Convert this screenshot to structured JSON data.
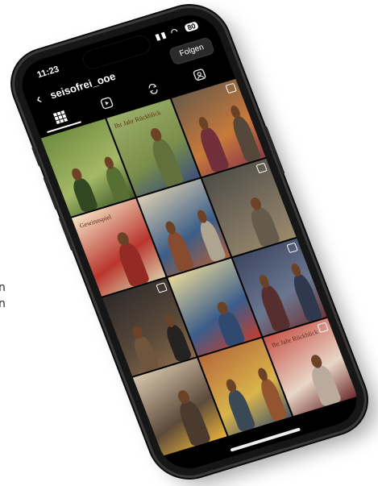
{
  "side_text": {
    "line1": "n",
    "line2": "n"
  },
  "status": {
    "time": "11:23",
    "battery": "80",
    "signal_icon": "signal-icon",
    "wifi_icon": "wifi-icon"
  },
  "profile": {
    "username": "seisofrei_ooe",
    "follow_label": "Folgen"
  },
  "tabs": [
    {
      "name": "grid-icon",
      "active": true
    },
    {
      "name": "reels-icon",
      "active": false
    },
    {
      "name": "repost-icon",
      "active": false
    },
    {
      "name": "tagged-icon",
      "active": false
    }
  ],
  "posts": [
    {
      "overlay": "",
      "caption": "",
      "colors": [
        "#6d8b3f",
        "#a5b866",
        "#3e5a2a"
      ]
    },
    {
      "overlay": "Ihr Jahr Rückblick",
      "caption": "",
      "colors": [
        "#9bb06a",
        "#7a8d4a",
        "#3b4f7a"
      ]
    },
    {
      "overlay": "",
      "caption": "",
      "colors": [
        "#6a5a4a",
        "#c87a3a",
        "#8d3a4a"
      ]
    },
    {
      "overlay": "Gewinnspiel",
      "caption": "",
      "colors": [
        "#f4e3c6",
        "#b9352d",
        "#d9c9a6"
      ]
    },
    {
      "overlay": "",
      "caption": "",
      "colors": [
        "#d9cdb3",
        "#3c5d86",
        "#a95f3b"
      ]
    },
    {
      "overlay": "",
      "caption": "",
      "colors": [
        "#4d4c46",
        "#7d7260",
        "#9b8a6b"
      ]
    },
    {
      "overlay": "",
      "caption": "",
      "colors": [
        "#2e2a2a",
        "#5a4a3a",
        "#8a6a4a"
      ]
    },
    {
      "overlay": "",
      "caption": "",
      "colors": [
        "#e8d89a",
        "#3b5c8a",
        "#c2402f"
      ]
    },
    {
      "overlay": "",
      "caption": "",
      "colors": [
        "#3c4660",
        "#6b7690",
        "#6d3a3a"
      ]
    },
    {
      "overlay": "",
      "caption": "",
      "colors": [
        "#d8c7ae",
        "#5c4a3a",
        "#e7b23a"
      ]
    },
    {
      "overlay": "",
      "caption": "",
      "colors": [
        "#b66a3c",
        "#d9b44a",
        "#4a5a6a"
      ]
    },
    {
      "overlay": "Ihr Jahr Rückblick",
      "caption": "",
      "colors": [
        "#c7544a",
        "#e8d6c6",
        "#6a2a2a"
      ]
    }
  ]
}
